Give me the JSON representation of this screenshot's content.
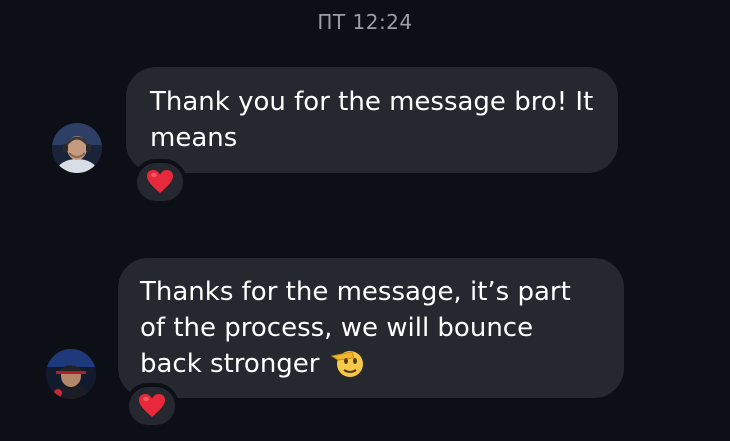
{
  "timestamp": "ПТ 12:24",
  "messages": [
    {
      "text": "Thank you for the message bro! It means",
      "reaction_icon": "red-heart-icon",
      "avatar_icon": "user-avatar-headset-icon"
    },
    {
      "text": "Thanks for the message, it’s part of the process, we will bounce back stronger",
      "inline_icon": "saluting-face-emoji",
      "reaction_icon": "red-heart-icon",
      "avatar_icon": "user-avatar-cap-icon"
    }
  ],
  "colors": {
    "background": "#0d0f16",
    "bubble": "#26282f",
    "timestamp": "#9a9ca6",
    "heart": "#e8293b"
  }
}
